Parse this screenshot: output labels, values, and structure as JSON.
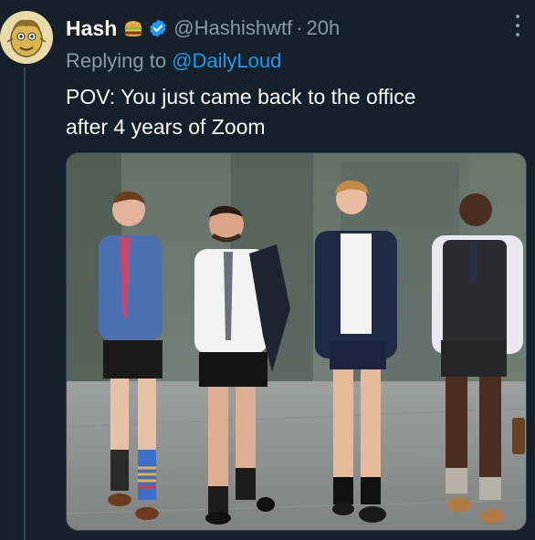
{
  "author": {
    "display_name": "Hash",
    "handle": "@Hashishwtf",
    "separator": "·",
    "time": "20h",
    "name_emoji": "burger-emoji",
    "verified": true
  },
  "reply": {
    "prefix": "Replying to ",
    "target": "@DailyLoud"
  },
  "tweet": {
    "text_line_1": "POV: You just came back to the office",
    "text_line_2": "after 4 years of Zoom"
  },
  "colors": {
    "background": "#15202b",
    "link": "#1d9bf0",
    "secondary_text": "#8b98a5",
    "verified": "#1d9bf0"
  },
  "icons": {
    "more": "more-options-icon",
    "verified": "verified-badge-icon",
    "avatar": "cartoon-avatar"
  }
}
